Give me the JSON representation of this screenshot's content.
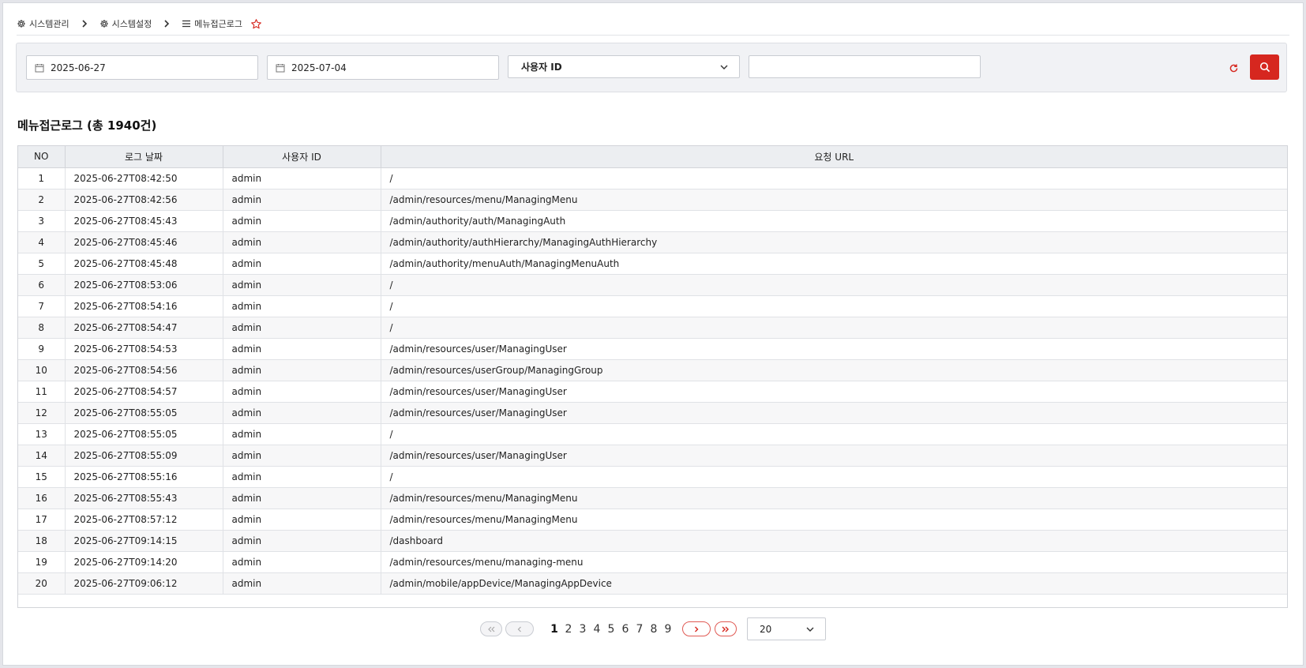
{
  "breadcrumb": {
    "items": [
      {
        "label": "시스템관리",
        "icon": "gear-icon"
      },
      {
        "label": "시스템설정",
        "icon": "gear-icon"
      },
      {
        "label": "메뉴접근로그",
        "icon": "list-icon"
      }
    ],
    "favorite_icon": "star-outline-icon"
  },
  "search": {
    "start_date": "2025-06-27",
    "end_date": "2025-07-04",
    "field_select": "사용자 ID",
    "keyword": ""
  },
  "colors": {
    "accent": "#d6271f"
  },
  "section": {
    "title": "메뉴접근로그 (총 1940건)"
  },
  "table": {
    "headers": [
      "NO",
      "로그 날짜",
      "사용자 ID",
      "요청 URL"
    ],
    "rows": [
      [
        "1",
        "2025-06-27T08:42:50",
        "admin",
        "/"
      ],
      [
        "2",
        "2025-06-27T08:42:56",
        "admin",
        "/admin/resources/menu/ManagingMenu"
      ],
      [
        "3",
        "2025-06-27T08:45:43",
        "admin",
        "/admin/authority/auth/ManagingAuth"
      ],
      [
        "4",
        "2025-06-27T08:45:46",
        "admin",
        "/admin/authority/authHierarchy/ManagingAuthHierarchy"
      ],
      [
        "5",
        "2025-06-27T08:45:48",
        "admin",
        "/admin/authority/menuAuth/ManagingMenuAuth"
      ],
      [
        "6",
        "2025-06-27T08:53:06",
        "admin",
        "/"
      ],
      [
        "7",
        "2025-06-27T08:54:16",
        "admin",
        "/"
      ],
      [
        "8",
        "2025-06-27T08:54:47",
        "admin",
        "/"
      ],
      [
        "9",
        "2025-06-27T08:54:53",
        "admin",
        "/admin/resources/user/ManagingUser"
      ],
      [
        "10",
        "2025-06-27T08:54:56",
        "admin",
        "/admin/resources/userGroup/ManagingGroup"
      ],
      [
        "11",
        "2025-06-27T08:54:57",
        "admin",
        "/admin/resources/user/ManagingUser"
      ],
      [
        "12",
        "2025-06-27T08:55:05",
        "admin",
        "/admin/resources/user/ManagingUser"
      ],
      [
        "13",
        "2025-06-27T08:55:05",
        "admin",
        "/"
      ],
      [
        "14",
        "2025-06-27T08:55:09",
        "admin",
        "/admin/resources/user/ManagingUser"
      ],
      [
        "15",
        "2025-06-27T08:55:16",
        "admin",
        "/"
      ],
      [
        "16",
        "2025-06-27T08:55:43",
        "admin",
        "/admin/resources/menu/ManagingMenu"
      ],
      [
        "17",
        "2025-06-27T08:57:12",
        "admin",
        "/admin/resources/menu/ManagingMenu"
      ],
      [
        "18",
        "2025-06-27T09:14:15",
        "admin",
        "/dashboard"
      ],
      [
        "19",
        "2025-06-27T09:14:20",
        "admin",
        "/admin/resources/menu/managing-menu"
      ],
      [
        "20",
        "2025-06-27T09:06:12",
        "admin",
        "/admin/mobile/appDevice/ManagingAppDevice"
      ]
    ]
  },
  "pagination": {
    "pages": [
      "1",
      "2",
      "3",
      "4",
      "5",
      "6",
      "7",
      "8",
      "9"
    ],
    "current": "1",
    "page_size": "20"
  }
}
